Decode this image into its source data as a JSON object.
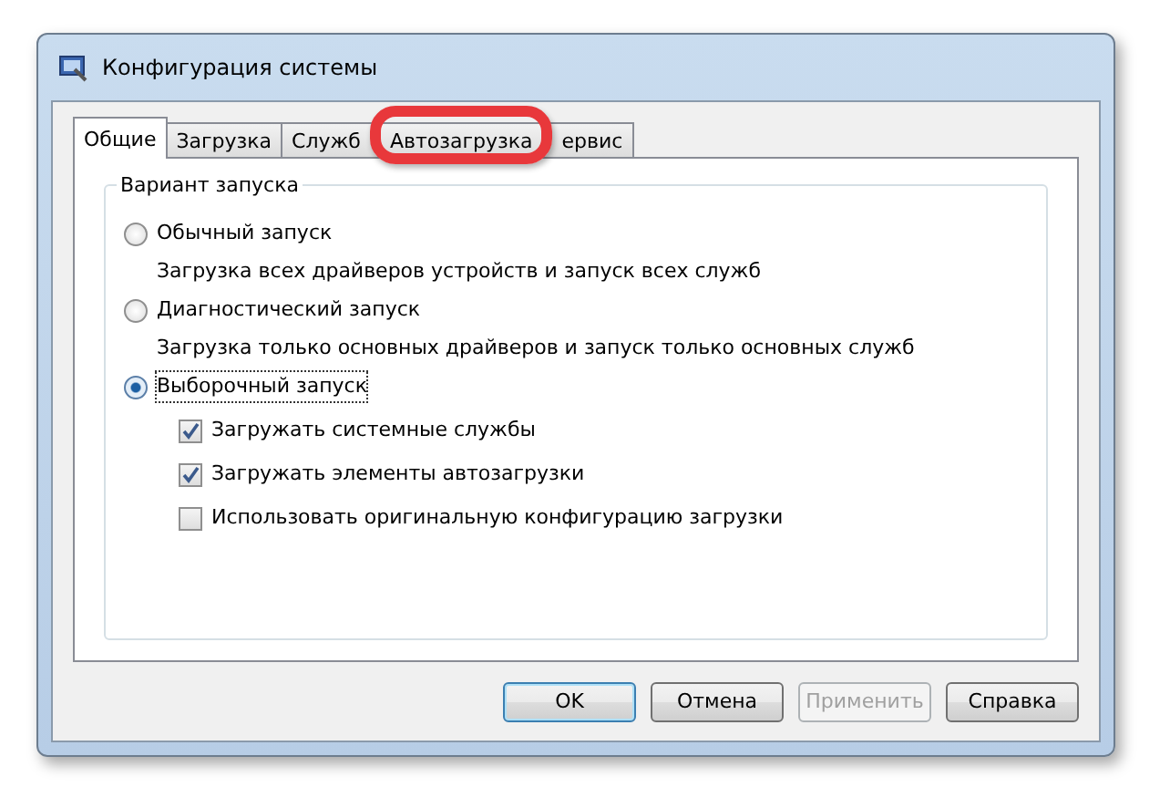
{
  "window": {
    "title": "Конфигурация системы"
  },
  "tabs": [
    {
      "label": "Общие",
      "selected": true
    },
    {
      "label": "Загрузка",
      "selected": false
    },
    {
      "label": "Служб",
      "selected": false
    },
    {
      "label": "Автозагрузка",
      "selected": false,
      "highlighted": true
    },
    {
      "label": "ервис",
      "selected": false
    }
  ],
  "group": {
    "title": "Вариант запуска",
    "options": [
      {
        "label": "Обычный запуск",
        "description": "Загрузка всех драйверов устройств и запуск всех служб",
        "selected": false
      },
      {
        "label": "Диагностический запуск",
        "description": "Загрузка только основных драйверов и запуск только основных служб",
        "selected": false
      },
      {
        "label": "Выборочный запуск",
        "selected": true,
        "checkboxes": [
          {
            "label": "Загружать системные службы",
            "checked": true
          },
          {
            "label": "Загружать элементы автозагрузки",
            "checked": true
          },
          {
            "label": "Использовать оригинальную конфигурацию загрузки",
            "checked": false
          }
        ]
      }
    ]
  },
  "buttons": [
    {
      "label": "OK",
      "default": true,
      "disabled": false
    },
    {
      "label": "Отмена",
      "default": false,
      "disabled": false
    },
    {
      "label": "Применить",
      "default": false,
      "disabled": true
    },
    {
      "label": "Справка",
      "default": false,
      "disabled": false
    }
  ]
}
